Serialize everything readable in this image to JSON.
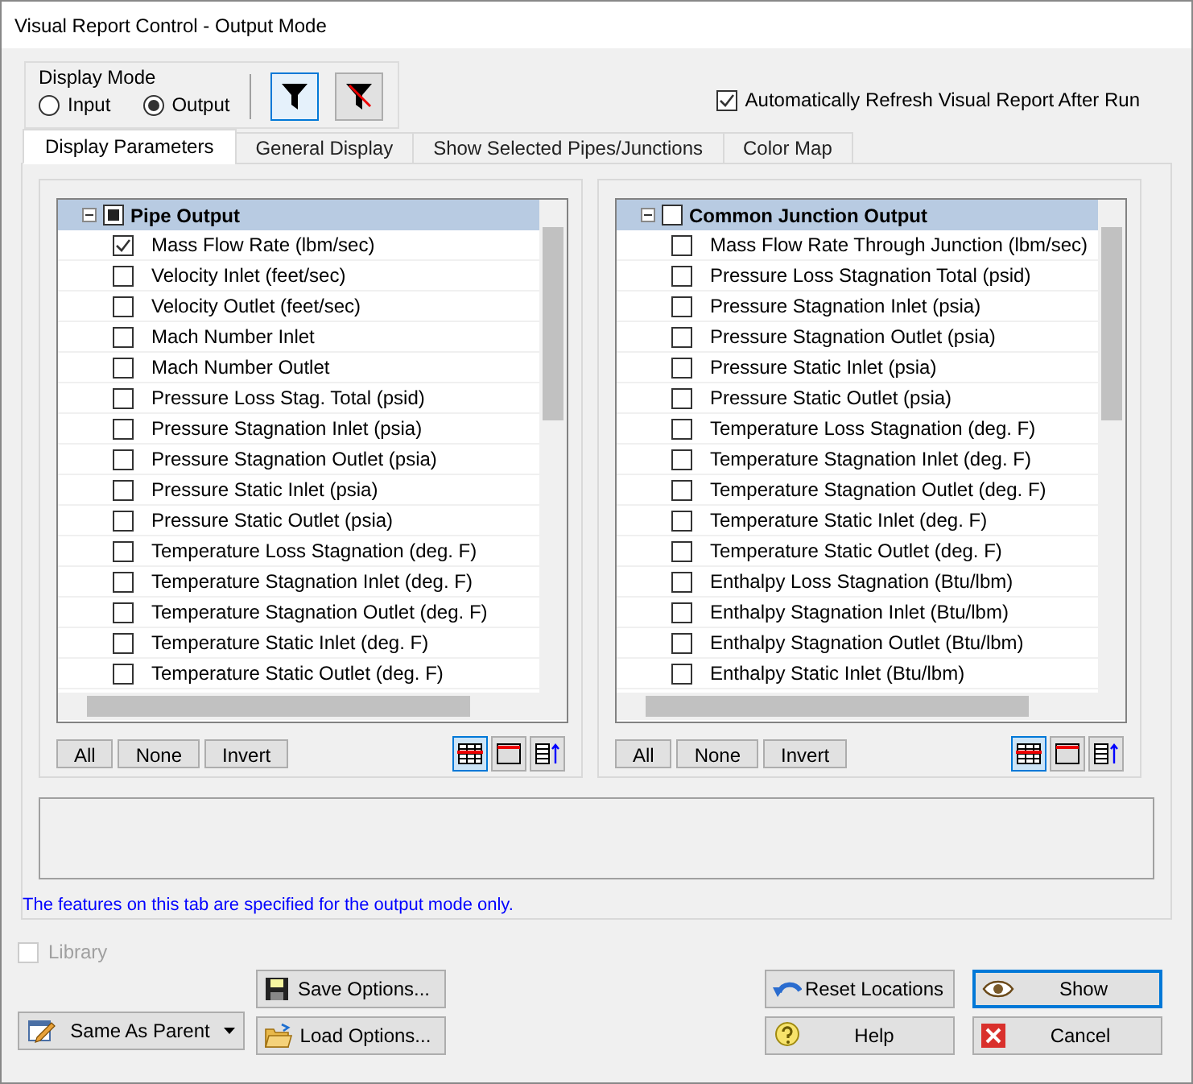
{
  "window": {
    "title": "Visual Report Control - Output Mode"
  },
  "display_mode": {
    "label": "Display Mode",
    "options": [
      {
        "label": "Input",
        "selected": false
      },
      {
        "label": "Output",
        "selected": true
      }
    ],
    "filters": [
      {
        "selected": true
      },
      {
        "selected": false
      }
    ]
  },
  "auto_refresh": {
    "label": "Automatically Refresh Visual Report After Run",
    "checked": true
  },
  "tabs": [
    {
      "label": "Display Parameters",
      "selected": true
    },
    {
      "label": "General Display",
      "selected": false
    },
    {
      "label": "Show Selected Pipes/Junctions",
      "selected": false
    },
    {
      "label": "Color Map",
      "selected": false
    }
  ],
  "panels": [
    {
      "title": "Pipe Output",
      "expanded": true,
      "mixed": true,
      "items": [
        {
          "label": "Mass Flow Rate (lbm/sec)",
          "checked": true
        },
        {
          "label": "Velocity Inlet (feet/sec)",
          "checked": false
        },
        {
          "label": "Velocity Outlet (feet/sec)",
          "checked": false
        },
        {
          "label": "Mach Number Inlet",
          "checked": false
        },
        {
          "label": "Mach Number Outlet",
          "checked": false
        },
        {
          "label": "Pressure Loss Stag. Total (psid)",
          "checked": false
        },
        {
          "label": "Pressure Stagnation Inlet (psia)",
          "checked": false
        },
        {
          "label": "Pressure Stagnation Outlet (psia)",
          "checked": false
        },
        {
          "label": "Pressure Static Inlet (psia)",
          "checked": false
        },
        {
          "label": "Pressure Static Outlet (psia)",
          "checked": false
        },
        {
          "label": "Temperature Loss Stagnation (deg. F)",
          "checked": false
        },
        {
          "label": "Temperature Stagnation Inlet (deg. F)",
          "checked": false
        },
        {
          "label": "Temperature Stagnation Outlet (deg. F)",
          "checked": false
        },
        {
          "label": "Temperature Static Inlet (deg. F)",
          "checked": false
        },
        {
          "label": "Temperature Static Outlet (deg. F)",
          "checked": false
        }
      ],
      "buttons": [
        "All",
        "None",
        "Invert"
      ]
    },
    {
      "title": "Common Junction Output",
      "expanded": true,
      "mixed": false,
      "items": [
        {
          "label": "Mass Flow Rate Through Junction (lbm/sec)",
          "checked": false
        },
        {
          "label": "Pressure Loss Stagnation Total (psid)",
          "checked": false
        },
        {
          "label": "Pressure Stagnation Inlet (psia)",
          "checked": false
        },
        {
          "label": "Pressure Stagnation Outlet (psia)",
          "checked": false
        },
        {
          "label": "Pressure Static Inlet (psia)",
          "checked": false
        },
        {
          "label": "Pressure Static Outlet (psia)",
          "checked": false
        },
        {
          "label": "Temperature Loss Stagnation (deg. F)",
          "checked": false
        },
        {
          "label": "Temperature Stagnation Inlet (deg. F)",
          "checked": false
        },
        {
          "label": "Temperature Stagnation Outlet (deg. F)",
          "checked": false
        },
        {
          "label": "Temperature Static Inlet (deg. F)",
          "checked": false
        },
        {
          "label": "Temperature Static Outlet (deg. F)",
          "checked": false
        },
        {
          "label": "Enthalpy Loss Stagnation (Btu/lbm)",
          "checked": false
        },
        {
          "label": "Enthalpy Stagnation Inlet (Btu/lbm)",
          "checked": false
        },
        {
          "label": "Enthalpy Stagnation Outlet (Btu/lbm)",
          "checked": false
        },
        {
          "label": "Enthalpy Static Inlet (Btu/lbm)",
          "checked": false
        }
      ],
      "buttons": [
        "All",
        "None",
        "Invert"
      ]
    }
  ],
  "note": "The features on this tab are specified for the output mode only.",
  "library": {
    "label": "Library",
    "checked": false,
    "disabled": true
  },
  "parent_menu": {
    "label": "Same As Parent"
  },
  "save_options": {
    "label": "Save Options..."
  },
  "load_options": {
    "label": "Load Options..."
  },
  "reset_locations": {
    "label": "Reset Locations"
  },
  "help": {
    "label": "Help"
  },
  "show": {
    "label": "Show",
    "default": true
  },
  "cancel": {
    "label": "Cancel",
    "default": false
  }
}
